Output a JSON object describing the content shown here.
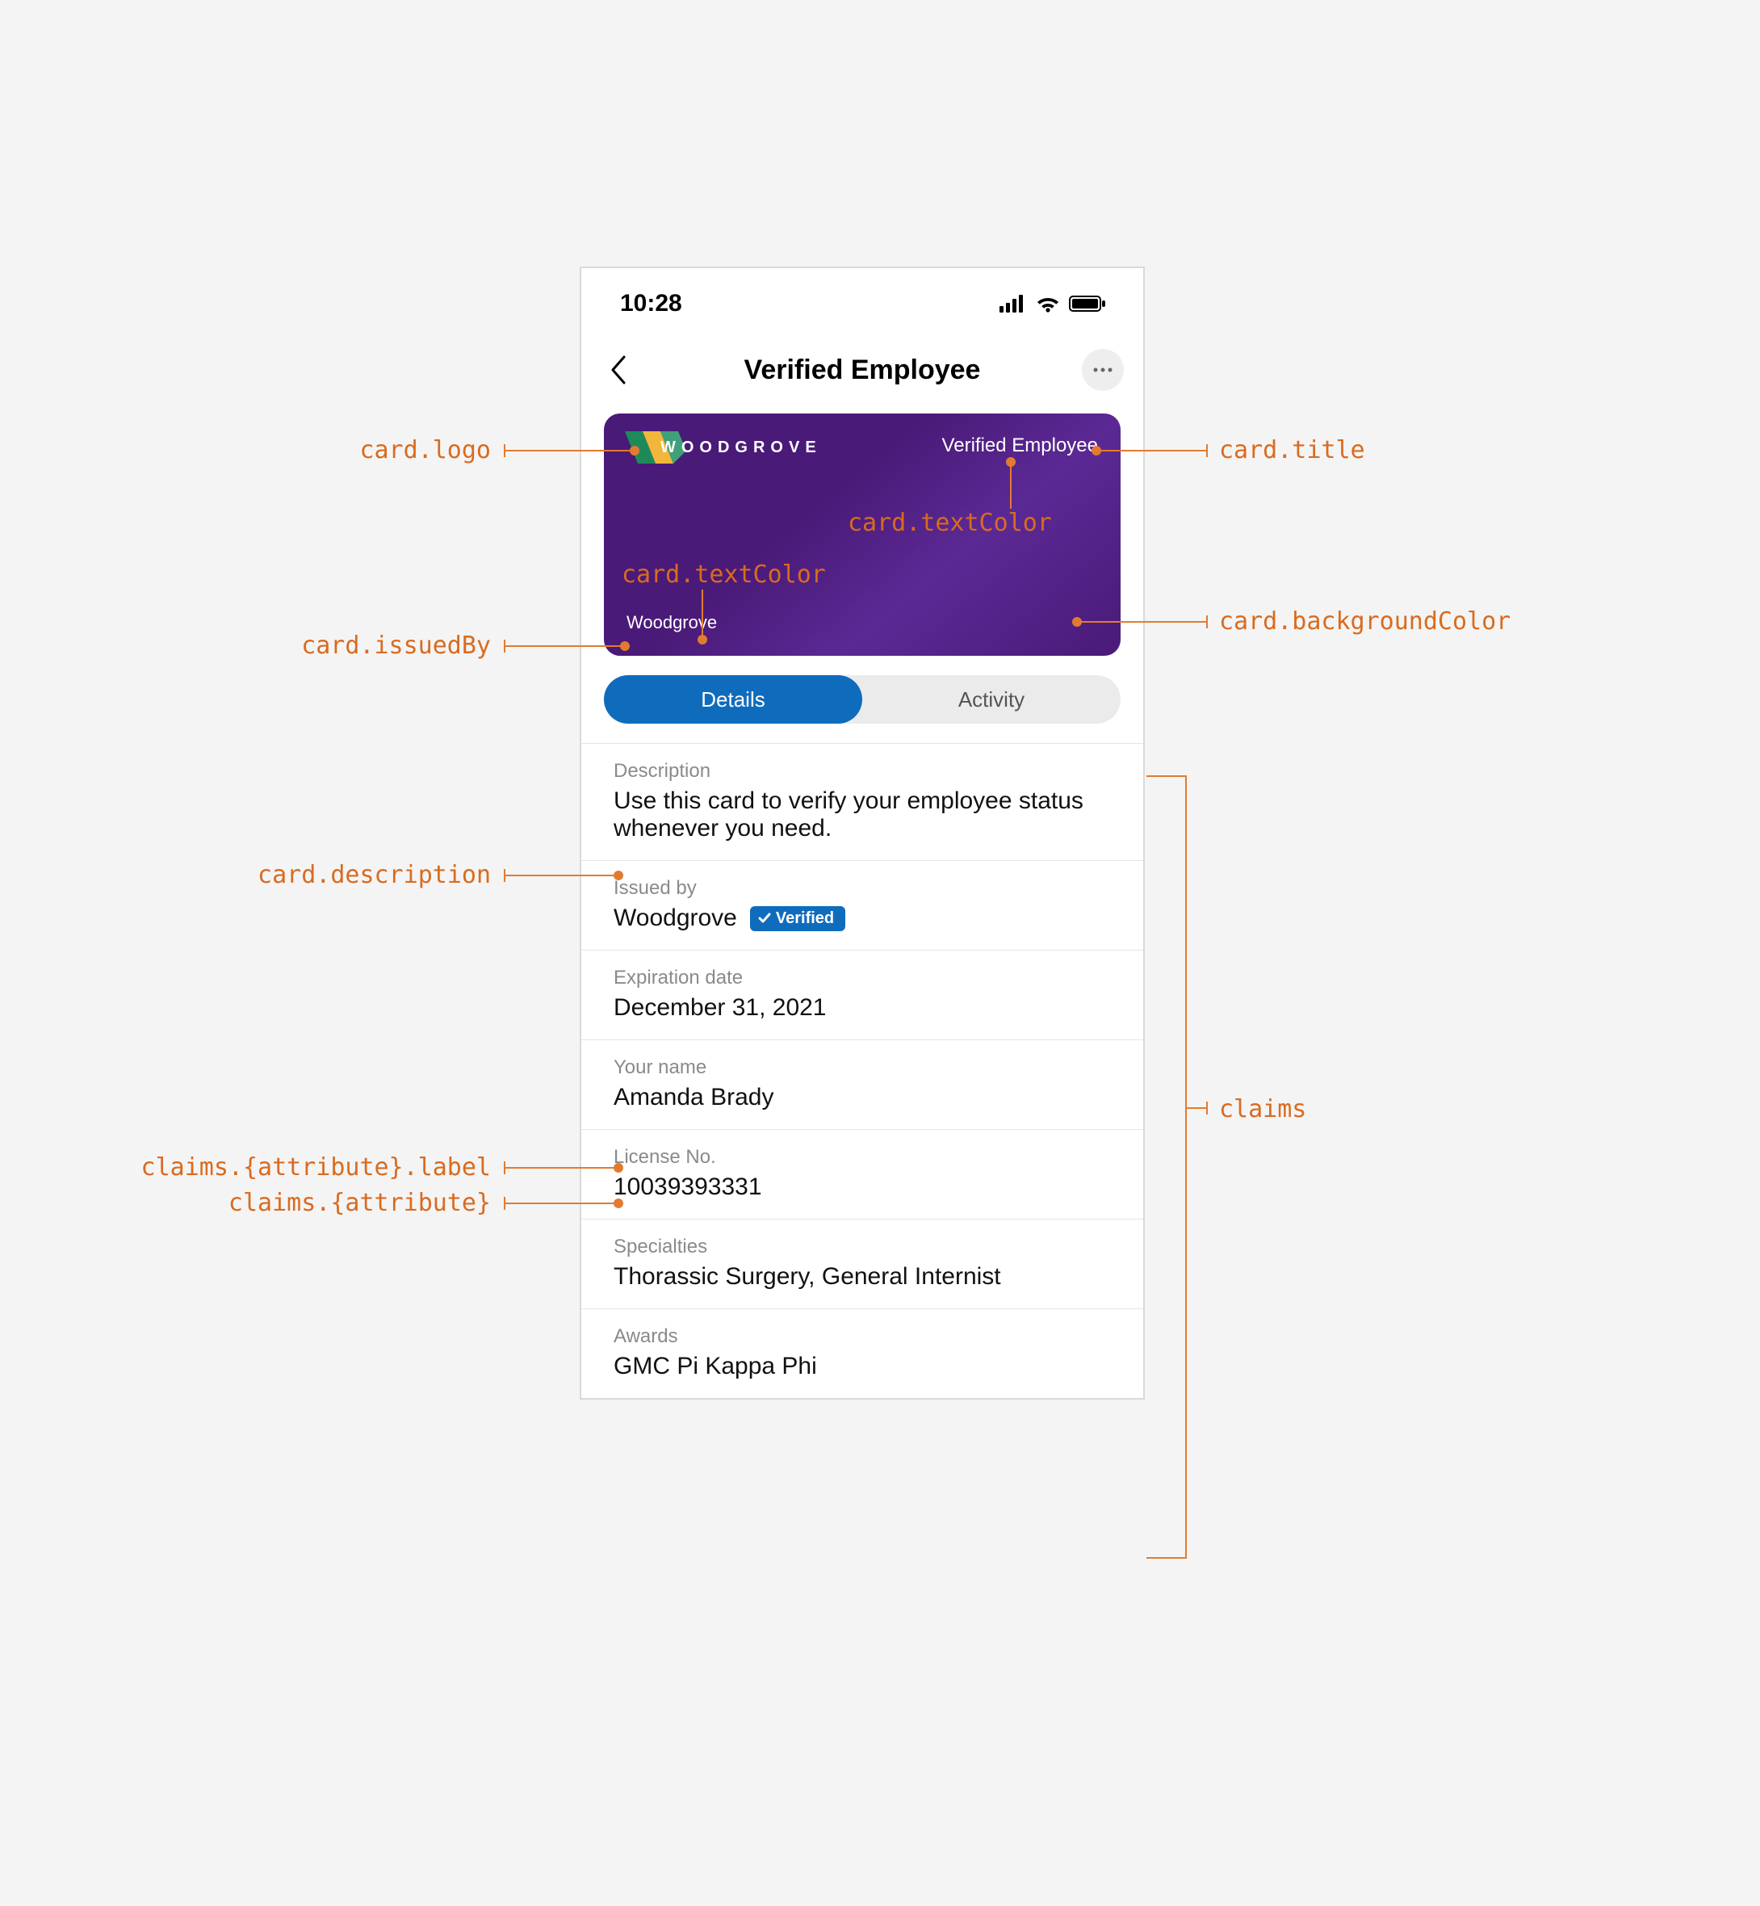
{
  "status": {
    "time": "10:28"
  },
  "header": {
    "title": "Verified Employee"
  },
  "card": {
    "logoText": "WOODGROVE",
    "title": "Verified Employee",
    "issuedBy": "Woodgrove"
  },
  "tabs": {
    "details": "Details",
    "activity": "Activity"
  },
  "rows": {
    "description": {
      "label": "Description",
      "value": "Use this card to verify your employee status whenever you need."
    },
    "issuedBy": {
      "label": "Issued by",
      "value": "Woodgrove",
      "badge": "Verified"
    },
    "expiration": {
      "label": "Expiration date",
      "value": "December 31, 2021"
    },
    "name": {
      "label": "Your name",
      "value": "Amanda Brady"
    },
    "license": {
      "label": "License No.",
      "value": "10039393331"
    },
    "specialties": {
      "label": "Specialties",
      "value": "Thorassic Surgery, General Internist"
    },
    "awards": {
      "label": "Awards",
      "value": "GMC Pi Kappa Phi"
    }
  },
  "annotations": {
    "logo": "card.logo",
    "title": "card.title",
    "textColor1": "card.textColor",
    "textColor2": "card.textColor",
    "issuedBy": "card.issuedBy",
    "bgColor": "card.backgroundColor",
    "description": "card.description",
    "claimLabel": "claims.{attribute}.label",
    "claimValue": "claims.{attribute}",
    "claims": "claims"
  }
}
